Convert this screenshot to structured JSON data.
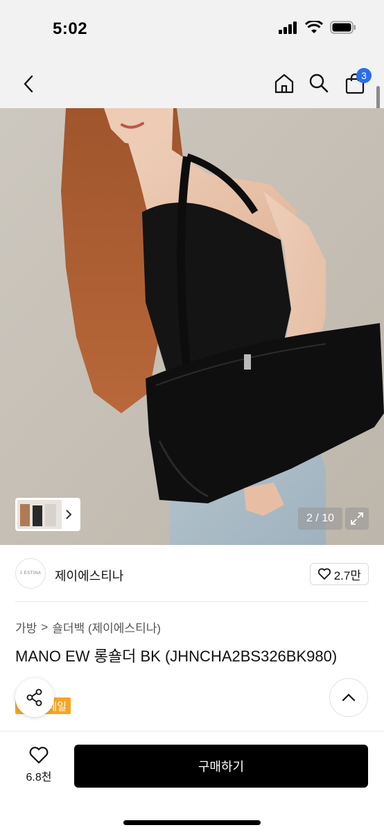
{
  "status_bar": {
    "time": "5:02"
  },
  "header": {
    "cart_count": "3"
  },
  "gallery": {
    "counter": "2 / 10"
  },
  "brand": {
    "logo_text": "J·ESTINA",
    "name": "제이에스티나",
    "like_count": "2.7만"
  },
  "breadcrumb": {
    "category": "가방",
    "separator": ">",
    "subcategory": "숄더백 (제이에스티나)"
  },
  "product": {
    "title": "MANO EW 롱숄더 BK (JHNCHA2BS326BK980)",
    "sale_badge": "세일"
  },
  "bottom_bar": {
    "wish_count": "6.8천",
    "buy_label": "구매하기"
  },
  "colors": {
    "accent_badge": "#2a6ee8",
    "sale": "#f5a623",
    "buy_button": "#000000"
  }
}
